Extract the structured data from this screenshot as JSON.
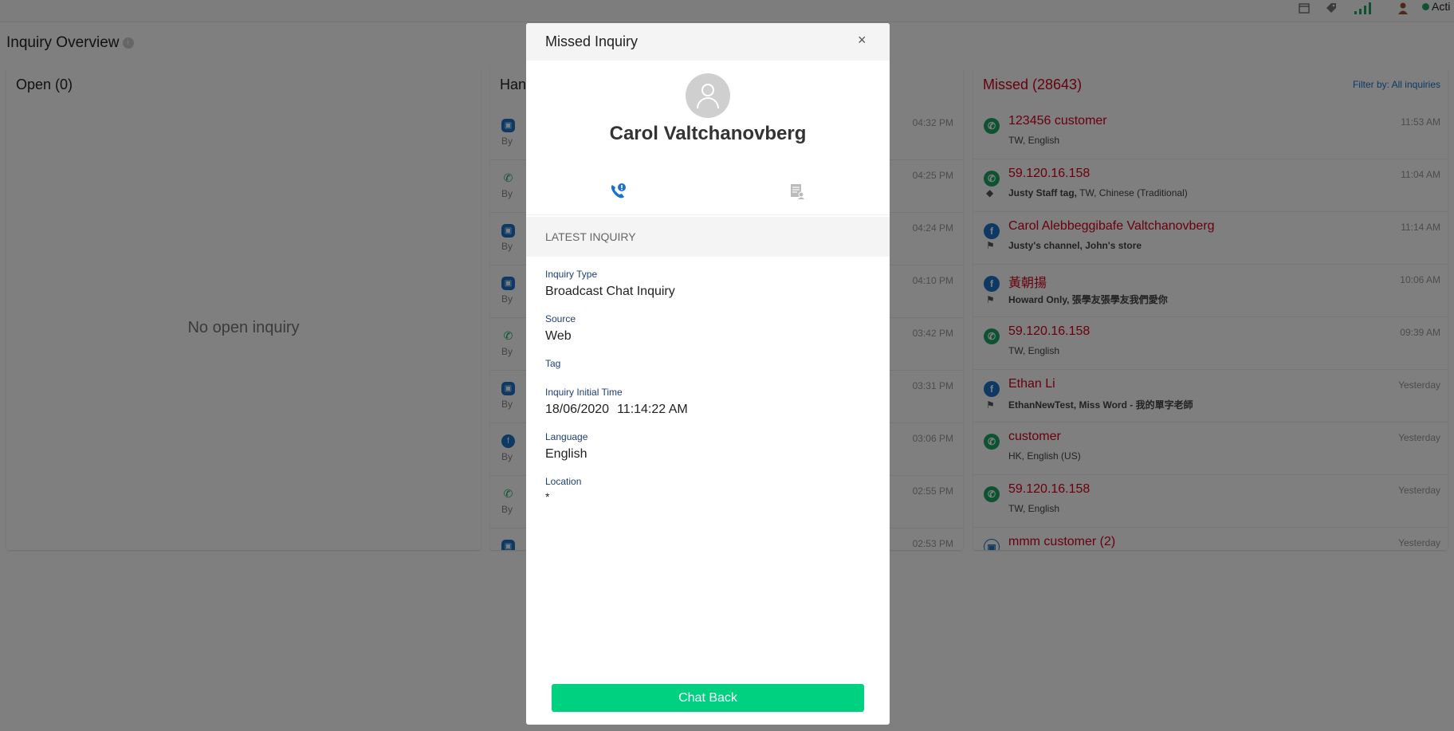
{
  "topbar": {
    "status_label": "Acti",
    "icons": [
      "calendar-icon",
      "tag-icon",
      "signal-icon",
      "user-avatar"
    ]
  },
  "page_title": "Inquiry Overview",
  "open_panel": {
    "title": "Open (0)",
    "empty_text": "No open inquiry"
  },
  "handled_panel": {
    "title": "Han",
    "rows": [
      {
        "channel": "web",
        "by": "By",
        "time": "04:32 PM"
      },
      {
        "channel": "phone",
        "by": "By",
        "time": "04:25 PM"
      },
      {
        "channel": "web",
        "by": "By",
        "time": "04:24 PM"
      },
      {
        "channel": "web",
        "by": "By",
        "time": "04:10 PM"
      },
      {
        "channel": "phone",
        "by": "By",
        "time": "03:42 PM"
      },
      {
        "channel": "web",
        "by": "By",
        "time": "03:31 PM"
      },
      {
        "channel": "facebook",
        "by": "By",
        "time": "03:06 PM"
      },
      {
        "channel": "phone",
        "by": "By",
        "time": "02:55 PM"
      },
      {
        "channel": "web",
        "by": "",
        "time": "02:53 PM"
      }
    ]
  },
  "missed_panel": {
    "title": "Missed (28643)",
    "filter_label": "Filter by: All inquiries",
    "rows": [
      {
        "channel": "phone",
        "name": "123456 customer",
        "time": "11:53 AM",
        "meta_bold": "",
        "meta": "TW, English",
        "meta_icon": ""
      },
      {
        "channel": "phone",
        "name": "59.120.16.158",
        "time": "11:04 AM",
        "meta_bold": "Justy Staff tag,",
        "meta": " TW, Chinese (Traditional)",
        "meta_icon": "tag-icon"
      },
      {
        "channel": "facebook",
        "name": "Carol Alebbeggibafe Valtchanovberg",
        "time": "11:14 AM",
        "meta_bold": "Justy's channel, John's store",
        "meta": "",
        "meta_icon": "flag-icon"
      },
      {
        "channel": "facebook",
        "name": "黃朝揚",
        "time": "10:06 AM",
        "meta_bold": "Howard Only, 張學友張學友我們愛你",
        "meta": "",
        "meta_icon": "flag-icon"
      },
      {
        "channel": "phone",
        "name": "59.120.16.158",
        "time": "09:39 AM",
        "meta_bold": "",
        "meta": "TW, English",
        "meta_icon": ""
      },
      {
        "channel": "facebook",
        "name": "Ethan Li",
        "time": "Yesterday",
        "meta_bold": "EthanNewTest, Miss Word - 我的單字老師",
        "meta": "",
        "meta_icon": "flag-icon"
      },
      {
        "channel": "phone",
        "name": "customer",
        "time": "Yesterday",
        "meta_bold": "",
        "meta": "HK, English (US)",
        "meta_icon": ""
      },
      {
        "channel": "phone",
        "name": "59.120.16.158",
        "time": "Yesterday",
        "meta_bold": "",
        "meta": "TW, English",
        "meta_icon": ""
      },
      {
        "channel": "web",
        "name": "mmm customer (2)",
        "time": "Yesterday",
        "meta_bold": "",
        "meta": "",
        "meta_icon": ""
      }
    ]
  },
  "modal": {
    "title": "Missed Inquiry",
    "close_glyph": "×",
    "customer_name": "Carol Valtchanovberg",
    "section_title": "LATEST INQUIRY",
    "fields": {
      "inquiry_type_label": "Inquiry Type",
      "inquiry_type_value": "Broadcast Chat Inquiry",
      "source_label": "Source",
      "source_value": "Web",
      "tag_label": "Tag",
      "initial_time_label": "Inquiry Initial Time",
      "initial_date": "18/06/2020",
      "initial_time": "11:14:22 AM",
      "language_label": "Language",
      "language_value": "English",
      "location_label": "Location",
      "location_value": "*"
    },
    "chat_back_label": "Chat Back"
  },
  "colors": {
    "missed_red": "#d0021b",
    "link_blue": "#1a73c8",
    "phone_green": "#1aa765",
    "chat_back_green": "#00d181",
    "field_label_blue": "#1c3f7a"
  }
}
